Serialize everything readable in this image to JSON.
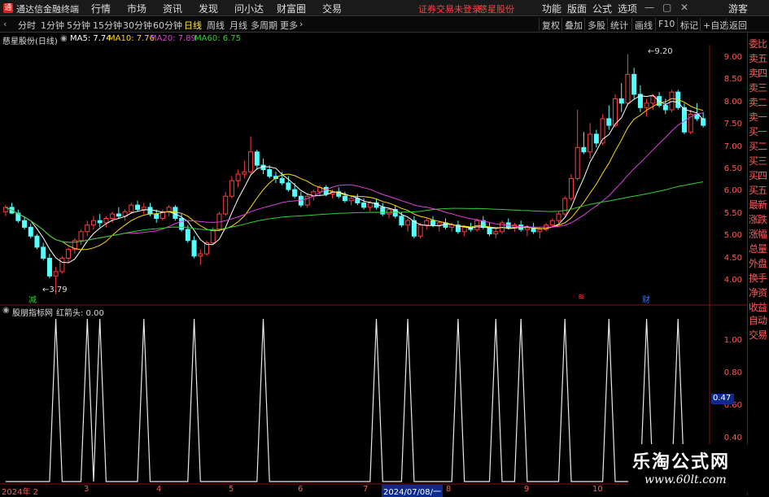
{
  "menubar": {
    "logo": "通",
    "app_title": "通达信金融终端",
    "menus": [
      "行情",
      "市场",
      "资讯",
      "发现",
      "问小达",
      "财富圈",
      "交易"
    ],
    "status_text": "证券交易未登录",
    "stock_link": "慈星股份",
    "right_menus": [
      "功能",
      "版面",
      "公式",
      "选项"
    ],
    "guest": "游客",
    "window_controls": [
      "—",
      "▢",
      "✕"
    ]
  },
  "periods": {
    "tabs": [
      "分时",
      "1分钟",
      "5分钟",
      "15分钟",
      "30分钟",
      "60分钟",
      "日线",
      "周线",
      "月线",
      "多周期",
      "更多"
    ],
    "active": "日线",
    "more_arrow": "›"
  },
  "toolbar": {
    "buttons": [
      "复权",
      "叠加",
      "多股",
      "统计",
      "画线",
      "F10",
      "标记",
      "+自选",
      "返回"
    ]
  },
  "main_chart": {
    "title": "慈星股份(日线)",
    "ma": [
      {
        "label": "MA5: 7.74",
        "color": "#ffffff"
      },
      {
        "label": "MA10: 7.76",
        "color": "#ffd800"
      },
      {
        "label": "MA20: 7.89",
        "color": "#e040e0"
      },
      {
        "label": "MA60: 6.75",
        "color": "#30d030"
      }
    ],
    "price_axis": [
      "9.00",
      "8.50",
      "8.00",
      "7.50",
      "7.00",
      "6.50",
      "6.00",
      "5.50",
      "5.00",
      "4.50",
      "4.00"
    ],
    "high_label": "9.20",
    "low_label": "3.79",
    "markers": [
      {
        "text": "减",
        "color": "#30d030"
      },
      {
        "text": "≋",
        "color": "#ff4040"
      },
      {
        "text": "财",
        "color": "#2a7bff"
      }
    ],
    "price_min": 3.6,
    "price_max": 9.4,
    "ohlc": [
      [
        5.65,
        5.8,
        5.55,
        5.75
      ],
      [
        5.75,
        5.85,
        5.6,
        5.62
      ],
      [
        5.62,
        5.7,
        5.4,
        5.45
      ],
      [
        5.45,
        5.55,
        5.25,
        5.3
      ],
      [
        5.3,
        5.38,
        5.05,
        5.1
      ],
      [
        5.1,
        5.15,
        4.8,
        4.85
      ],
      [
        4.85,
        4.95,
        4.55,
        4.6
      ],
      [
        4.6,
        4.7,
        4.15,
        4.2
      ],
      [
        4.2,
        4.4,
        3.79,
        4.3
      ],
      [
        4.3,
        4.65,
        4.25,
        4.6
      ],
      [
        4.6,
        4.85,
        4.5,
        4.8
      ],
      [
        4.8,
        5.05,
        4.7,
        5.0
      ],
      [
        5.0,
        5.25,
        4.9,
        5.2
      ],
      [
        5.2,
        5.45,
        5.1,
        5.35
      ],
      [
        5.35,
        5.55,
        5.25,
        5.45
      ],
      [
        5.45,
        5.6,
        5.3,
        5.4
      ],
      [
        5.4,
        5.55,
        5.3,
        5.5
      ],
      [
        5.5,
        5.65,
        5.4,
        5.6
      ],
      [
        5.6,
        5.75,
        5.5,
        5.55
      ],
      [
        5.55,
        5.7,
        5.45,
        5.65
      ],
      [
        5.65,
        5.85,
        5.6,
        5.8
      ],
      [
        5.8,
        5.9,
        5.65,
        5.7
      ],
      [
        5.7,
        5.85,
        5.6,
        5.75
      ],
      [
        5.75,
        5.85,
        5.55,
        5.6
      ],
      [
        5.6,
        5.7,
        5.4,
        5.5
      ],
      [
        5.5,
        5.7,
        5.45,
        5.65
      ],
      [
        5.65,
        5.8,
        5.55,
        5.75
      ],
      [
        5.75,
        5.8,
        5.45,
        5.5
      ],
      [
        5.5,
        5.6,
        5.2,
        5.25
      ],
      [
        5.25,
        5.35,
        4.95,
        5.0
      ],
      [
        5.0,
        5.1,
        4.6,
        4.65
      ],
      [
        4.65,
        4.8,
        4.45,
        4.7
      ],
      [
        4.7,
        5.0,
        4.65,
        4.95
      ],
      [
        4.95,
        5.3,
        4.9,
        5.25
      ],
      [
        5.25,
        5.65,
        5.2,
        5.6
      ],
      [
        5.6,
        6.1,
        5.55,
        6.0
      ],
      [
        6.0,
        6.45,
        5.95,
        6.35
      ],
      [
        6.35,
        6.6,
        6.2,
        6.5
      ],
      [
        6.5,
        6.8,
        6.4,
        6.55
      ],
      [
        6.55,
        7.35,
        6.5,
        7.0
      ],
      [
        7.0,
        7.05,
        6.6,
        6.7
      ],
      [
        6.7,
        6.85,
        6.5,
        6.6
      ],
      [
        6.6,
        6.7,
        6.4,
        6.45
      ],
      [
        6.45,
        6.55,
        6.3,
        6.4
      ],
      [
        6.4,
        6.55,
        6.25,
        6.3
      ],
      [
        6.3,
        6.45,
        6.1,
        6.15
      ],
      [
        6.15,
        6.3,
        5.95,
        6.0
      ],
      [
        6.0,
        6.1,
        5.75,
        5.8
      ],
      [
        5.8,
        6.05,
        5.75,
        6.0
      ],
      [
        6.0,
        6.15,
        5.9,
        6.1
      ],
      [
        6.1,
        6.25,
        6.0,
        6.2
      ],
      [
        6.2,
        6.25,
        6.0,
        6.05
      ],
      [
        6.05,
        6.15,
        5.95,
        6.1
      ],
      [
        6.1,
        6.2,
        5.95,
        6.0
      ],
      [
        6.0,
        6.1,
        5.85,
        5.9
      ],
      [
        5.9,
        6.0,
        5.8,
        5.95
      ],
      [
        5.95,
        6.05,
        5.8,
        5.85
      ],
      [
        5.85,
        5.95,
        5.7,
        5.75
      ],
      [
        5.75,
        5.9,
        5.65,
        5.85
      ],
      [
        5.85,
        5.95,
        5.7,
        5.75
      ],
      [
        5.75,
        5.85,
        5.55,
        5.6
      ],
      [
        5.6,
        5.75,
        5.5,
        5.7
      ],
      [
        5.7,
        5.8,
        5.5,
        5.55
      ],
      [
        5.55,
        5.65,
        5.3,
        5.35
      ],
      [
        5.35,
        5.5,
        5.2,
        5.45
      ],
      [
        5.45,
        5.55,
        5.05,
        5.1
      ],
      [
        5.1,
        5.4,
        5.05,
        5.35
      ],
      [
        5.35,
        5.5,
        5.25,
        5.45
      ],
      [
        5.45,
        5.55,
        5.3,
        5.35
      ],
      [
        5.35,
        5.45,
        5.2,
        5.4
      ],
      [
        5.4,
        5.5,
        5.25,
        5.3
      ],
      [
        5.3,
        5.4,
        5.2,
        5.35
      ],
      [
        5.35,
        5.45,
        5.15,
        5.2
      ],
      [
        5.2,
        5.35,
        5.1,
        5.3
      ],
      [
        5.3,
        5.4,
        5.2,
        5.25
      ],
      [
        5.25,
        5.5,
        5.2,
        5.45
      ],
      [
        5.45,
        5.55,
        5.25,
        5.3
      ],
      [
        5.3,
        5.4,
        5.1,
        5.15
      ],
      [
        5.15,
        5.25,
        5.05,
        5.2
      ],
      [
        5.2,
        5.45,
        5.15,
        5.4
      ],
      [
        5.4,
        5.5,
        5.25,
        5.3
      ],
      [
        5.3,
        5.4,
        5.2,
        5.35
      ],
      [
        5.35,
        5.45,
        5.2,
        5.25
      ],
      [
        5.25,
        5.35,
        5.1,
        5.3
      ],
      [
        5.3,
        5.4,
        5.15,
        5.2
      ],
      [
        5.2,
        5.3,
        5.05,
        5.25
      ],
      [
        5.25,
        5.4,
        5.2,
        5.35
      ],
      [
        5.35,
        5.5,
        5.3,
        5.45
      ],
      [
        5.45,
        5.65,
        5.4,
        5.6
      ],
      [
        5.6,
        6.0,
        5.55,
        5.95
      ],
      [
        5.95,
        6.5,
        5.9,
        6.4
      ],
      [
        6.4,
        7.95,
        6.35,
        7.1
      ],
      [
        7.1,
        7.45,
        6.95,
        7.0
      ],
      [
        7.0,
        7.65,
        6.85,
        7.4
      ],
      [
        7.4,
        7.5,
        7.1,
        7.2
      ],
      [
        7.2,
        7.85,
        7.15,
        7.75
      ],
      [
        7.75,
        8.05,
        7.5,
        7.6
      ],
      [
        7.6,
        8.3,
        7.55,
        8.2
      ],
      [
        8.2,
        8.55,
        7.9,
        8.1
      ],
      [
        8.1,
        9.2,
        8.05,
        8.75
      ],
      [
        8.75,
        8.9,
        8.2,
        8.3
      ],
      [
        8.3,
        8.5,
        7.9,
        8.0
      ],
      [
        8.0,
        8.2,
        7.8,
        8.1
      ],
      [
        8.1,
        8.3,
        7.95,
        8.25
      ],
      [
        8.25,
        8.35,
        8.0,
        8.05
      ],
      [
        8.05,
        8.2,
        7.85,
        7.95
      ],
      [
        7.95,
        8.4,
        7.9,
        8.35
      ],
      [
        8.35,
        8.4,
        7.95,
        8.0
      ],
      [
        8.0,
        8.1,
        7.4,
        7.45
      ],
      [
        7.45,
        7.95,
        7.4,
        7.85
      ],
      [
        7.85,
        8.1,
        7.7,
        7.75
      ],
      [
        7.75,
        7.9,
        7.55,
        7.6
      ]
    ]
  },
  "indicator": {
    "title": "股朋指标网",
    "value_label": "红箭头: 0.00",
    "axis": [
      "1.00",
      "0.80",
      "0.60",
      "0.40"
    ],
    "current_value": "0.47",
    "spike_bars": [
      8,
      13,
      15,
      22,
      30,
      41,
      59,
      64,
      72,
      78,
      82,
      89,
      96,
      102,
      107,
      112
    ]
  },
  "sidebar": {
    "items": [
      "委比",
      "卖五",
      "卖四",
      "卖三",
      "卖二",
      "卖一",
      "买一",
      "买二",
      "买三",
      "买四",
      "买五",
      "最新",
      "涨跌",
      "涨幅",
      "总量",
      "外盘",
      "换手",
      "净资",
      "收益"
    ],
    "bottom_items": [
      "自动",
      "交易"
    ]
  },
  "date_axis": {
    "labels": [
      "2024年 2",
      "3",
      "4",
      "5",
      "6",
      "7",
      "2024/07/08/一",
      "8",
      "9",
      "10"
    ]
  },
  "watermark": {
    "title": "乐淘公式网",
    "url": "www.60lt.com"
  }
}
